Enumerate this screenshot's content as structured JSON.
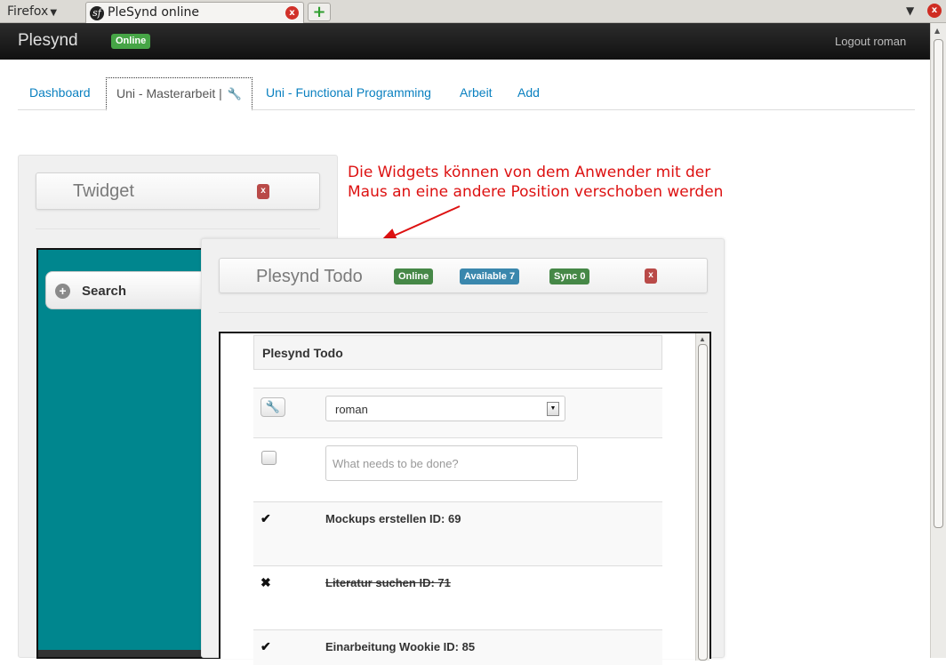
{
  "browser": {
    "menu_label": "Firefox",
    "tab_title": "PleSynd online",
    "new_tab_symbol": "+",
    "close_symbol": "x"
  },
  "navbar": {
    "brand": "Plesynd",
    "status": "Online",
    "logout": "Logout roman"
  },
  "tabs": [
    {
      "label": "Dashboard"
    },
    {
      "label": "Uni - Masterarbeit |"
    },
    {
      "label": "Uni - Functional Programming"
    },
    {
      "label": "Arbeit"
    },
    {
      "label": "Add"
    }
  ],
  "twidget": {
    "title": "Twidget",
    "close": "x",
    "search_label": "Search"
  },
  "annotation": {
    "line1": "Die Widgets können von dem Anwender mit der",
    "line2": "Maus an eine andere Position verschoben werden"
  },
  "todo_widget": {
    "title": "Plesynd Todo",
    "online": "Online",
    "available": "Available 7",
    "sync": "Sync 0",
    "close": "x",
    "inner_title": "Plesynd Todo",
    "user_select": "roman",
    "new_placeholder": "What needs to be done?",
    "items": [
      {
        "text": "Mockups erstellen ID: 69",
        "mark": "✔",
        "done": false
      },
      {
        "text": "Literatur suchen ID: 71",
        "mark": "✖",
        "done": true
      },
      {
        "text": "Einarbeitung Wookie ID: 85",
        "mark": "✔",
        "done": false
      }
    ]
  },
  "colors": {
    "accent_link": "#0a80c0",
    "online_green": "#46a546",
    "annotation_red": "#dd1111",
    "twitter_teal": "#00868e"
  }
}
